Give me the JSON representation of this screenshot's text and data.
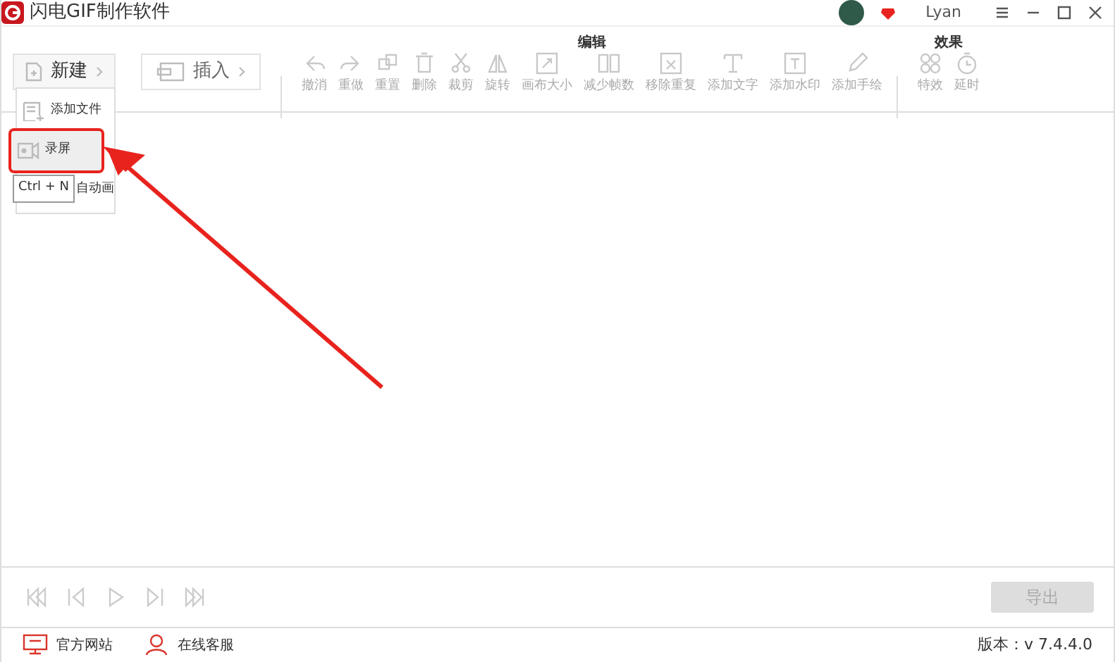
{
  "window": {
    "title": "闪电GIF制作软件",
    "user": "Lyan"
  },
  "toolbar": {
    "new_button": {
      "label": "新建",
      "expanded": true
    },
    "insert_button": {
      "label": "插入"
    },
    "groups": [
      {
        "label": "编辑",
        "tools": [
          {
            "label": "撤消",
            "disabled": true
          },
          {
            "label": "重做",
            "disabled": true
          },
          {
            "label": "重置",
            "disabled": true
          },
          {
            "label": "删除",
            "disabled": true
          },
          {
            "label": "裁剪",
            "disabled": true
          },
          {
            "label": "旋转",
            "disabled": true
          },
          {
            "label": "画布大小",
            "disabled": true
          },
          {
            "label": "减少帧数",
            "disabled": true
          },
          {
            "label": "移除重复",
            "disabled": true
          },
          {
            "label": "添加文字",
            "disabled": true
          },
          {
            "label": "添加水印",
            "disabled": true
          },
          {
            "label": "添加手绘",
            "disabled": true
          }
        ]
      },
      {
        "label": "效果",
        "tools": [
          {
            "label": "特效",
            "disabled": true
          },
          {
            "label": "延时",
            "disabled": true
          }
        ]
      }
    ]
  },
  "new_menu": [
    {
      "label": "添加文件",
      "selected": false
    },
    {
      "label": "录屏",
      "selected": true
    },
    {
      "label": "自动画",
      "selected": false
    }
  ],
  "tooltip": "Ctrl + N",
  "player": {
    "buttons": [
      {
        "kind": "first",
        "disabled": true
      },
      {
        "kind": "prev",
        "disabled": true
      },
      {
        "kind": "play",
        "disabled": true
      },
      {
        "kind": "next",
        "disabled": true
      },
      {
        "kind": "last",
        "disabled": true
      }
    ],
    "export_button": {
      "label": "导出",
      "disabled": true
    }
  },
  "footer": {
    "links": [
      {
        "kind": "website",
        "label": "官方网站"
      },
      {
        "kind": "service",
        "label": "在线客服"
      }
    ],
    "version": "版本：v 7.4.4.0"
  }
}
